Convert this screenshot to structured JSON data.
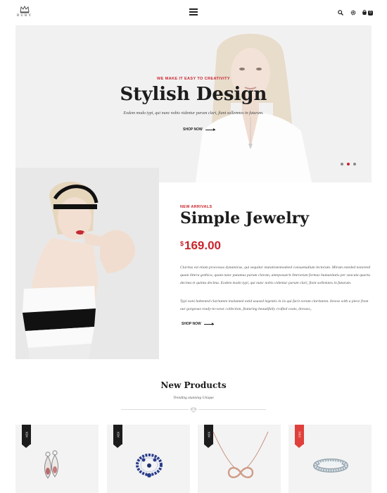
{
  "header": {
    "brand": "RUBY",
    "icons": [
      "crown-logo-icon",
      "menu-icon",
      "search-icon",
      "settings-icon",
      "cart-icon"
    ],
    "cart_count": "0"
  },
  "hero": {
    "kicker": "WE MAKE IT EASY TO CREATIVITY",
    "title": "Stylish Design",
    "subtitle": "Eodem modo typi, qui nunc nobis videntur parum clari, fiant sollemnes in futurum.",
    "shop_label": "SHOP NOW",
    "slides": 3,
    "active_slide": 2
  },
  "feature": {
    "kicker": "NEW ARRIVALS",
    "title": "Simple Jewelry",
    "currency": "$",
    "price": "169.00",
    "paragraph1": "Claritas est etiam processus dynamicus, qui sequitur mutationemodeed consuetudium lectorum. Mirum esteded notareed quam littera gothica, quam nunc putamus parum claram, anteposuerit litterarum formas humanitatis per seacula quarta decima et quinta decima. Eodem modo typi, qui nunc nobis videntur parum clari, fiant sollemnes in futurum.",
    "paragraph2": "Typi noni habented claritatem insitamed estid usused legentis in iis qui facit eorum claritatem. Invese with a piece from our gorgeous ready-to-wear collection, featuring beautifully crafted coats, dresses,.",
    "shop_label": "SHOP NOW"
  },
  "new_products": {
    "title": "New Products",
    "subtitle": "Trending stunning Unique",
    "cards": [
      {
        "badge": "NEW",
        "product": "drop-earrings"
      },
      {
        "badge": "NEW",
        "product": "sapphire-jewelry-set"
      },
      {
        "badge": "NEW",
        "product": "infinity-necklace"
      },
      {
        "badge": "SALE",
        "product": "diamond-ring"
      }
    ]
  },
  "colors": {
    "accent": "#c8252c",
    "dark": "#1c1c1c",
    "hero_bg": "#f2f1f2",
    "card_bg": "#f3f3f4"
  }
}
